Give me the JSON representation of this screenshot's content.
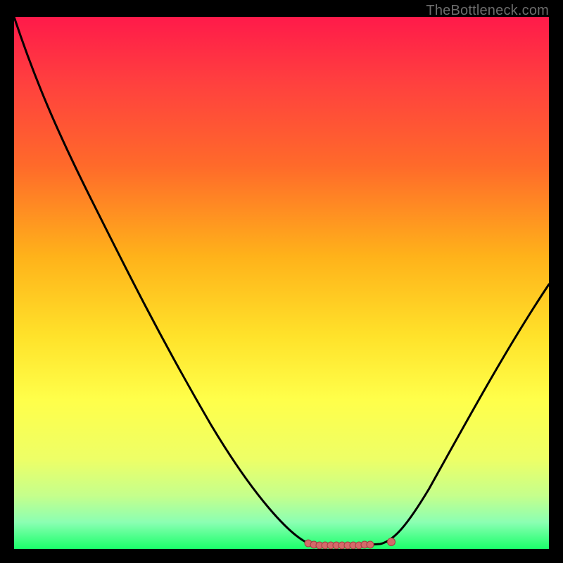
{
  "watermark": "TheBottleneck.com",
  "colors": {
    "frame_background": "#000000",
    "curve_stroke": "#000000",
    "marker_fill": "#d46a6a",
    "marker_stroke": "#a04040",
    "gradient_top": "#ff1a4a",
    "gradient_bottom": "#1aff6a"
  },
  "chart_data": {
    "type": "line",
    "title": "",
    "xlabel": "",
    "ylabel": "",
    "xlim": [
      0,
      100
    ],
    "ylim": [
      0,
      100
    ],
    "description": "Bottleneck percentage curve. High (red) at the extremes, reaching near zero (green) in a flat minimum region roughly between x≈54 and x≈70. A small marker cluster sits on the flat minimum and a single marker at the right end of it.",
    "series": [
      {
        "name": "bottleneck-curve",
        "x": [
          0,
          5,
          10,
          15,
          20,
          25,
          30,
          35,
          40,
          45,
          50,
          54,
          58,
          62,
          66,
          70,
          74,
          78,
          82,
          86,
          90,
          94,
          98,
          100
        ],
        "y": [
          100,
          95,
          88,
          80,
          72,
          63,
          54,
          45,
          36,
          27,
          17,
          6,
          1,
          0.5,
          0.5,
          1,
          5,
          12,
          20,
          28,
          35,
          42,
          48,
          51
        ]
      }
    ],
    "markers": [
      {
        "name": "min-plateau-cluster",
        "x_range": [
          54,
          66
        ],
        "y": 0.8
      },
      {
        "name": "min-plateau-end-dot",
        "x": 70,
        "y": 1.2
      }
    ],
    "grid": false,
    "legend": false
  }
}
